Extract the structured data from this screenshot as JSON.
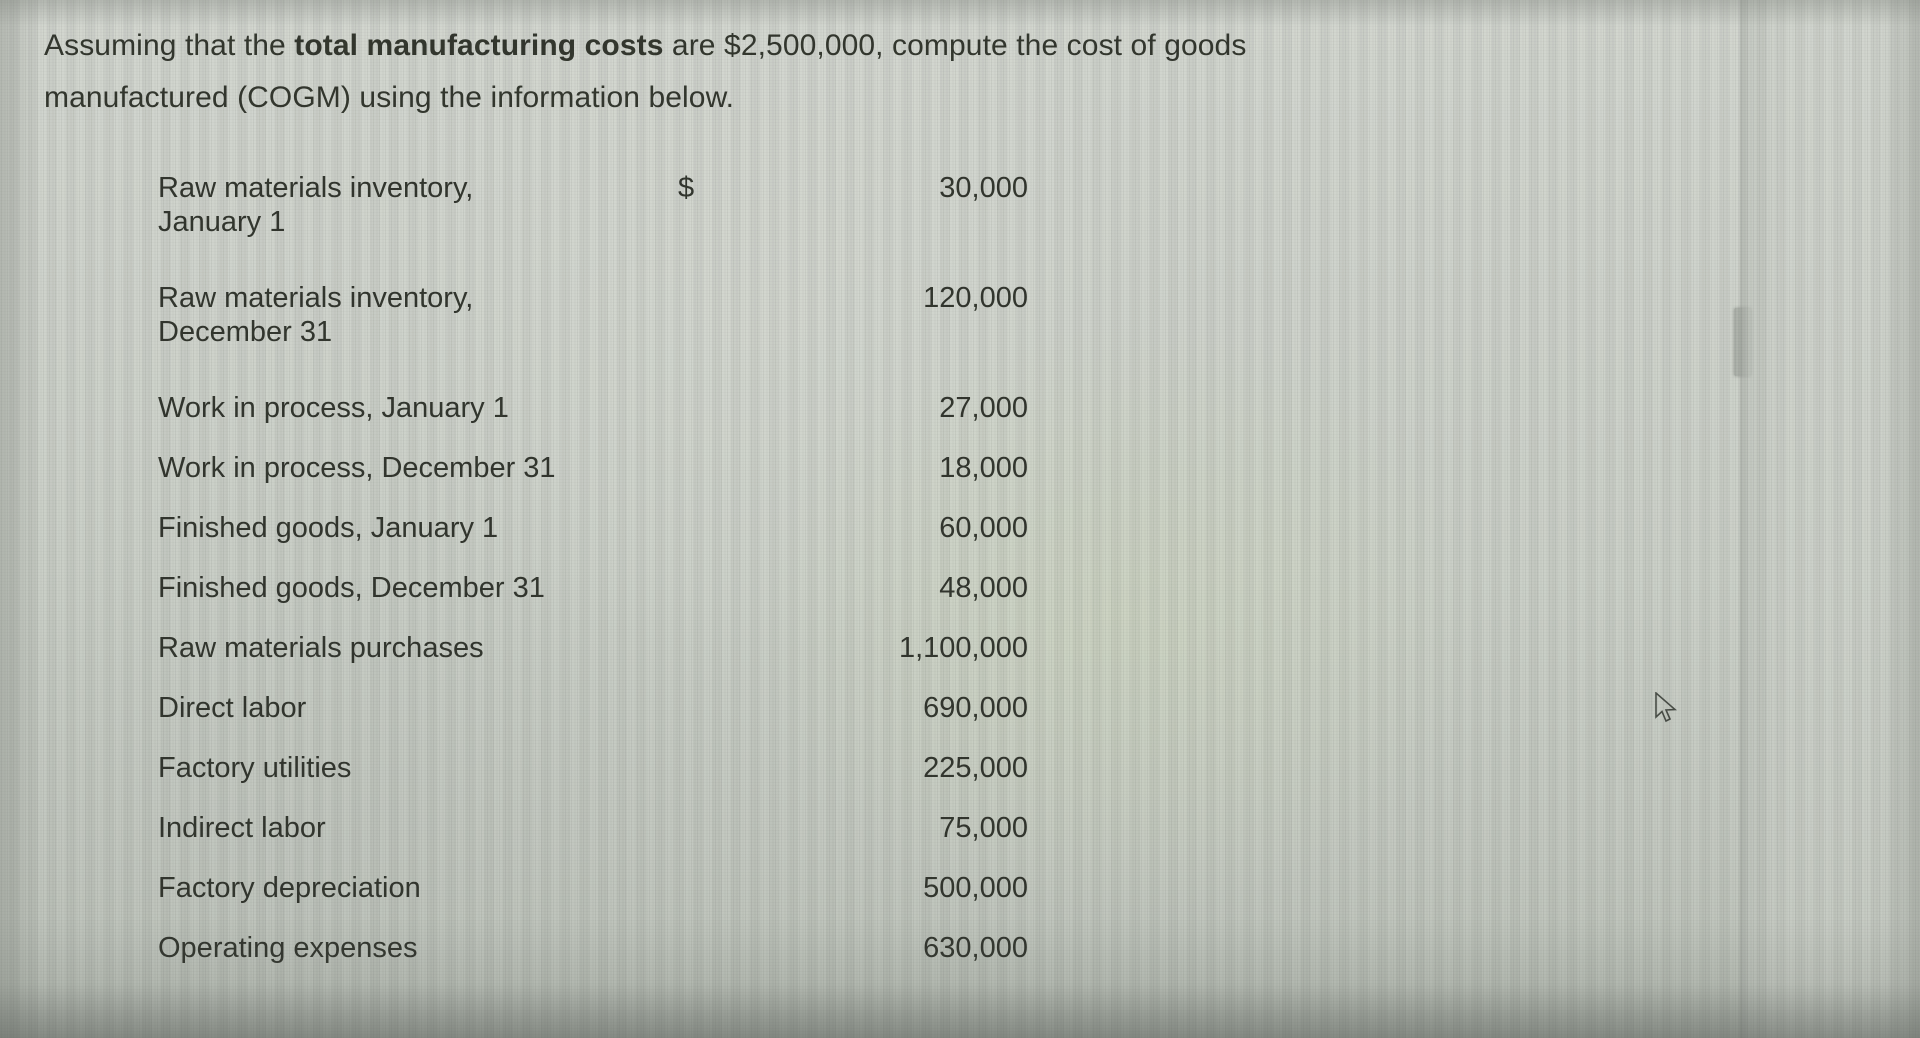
{
  "question": {
    "text_before_bold": "Assuming that the ",
    "bold_phrase": "total manufacturing costs",
    "text_after_bold": " are $2,500,000, compute the cost of goods manufactured (COGM) using the information below."
  },
  "table": {
    "currency_symbol": "$",
    "rows": [
      {
        "label": "Raw materials inventory,\nJanuary 1",
        "amount": "30,000",
        "has_currency": true
      },
      {
        "label": "Raw materials inventory,\nDecember 31",
        "amount": "120,000",
        "has_currency": false
      },
      {
        "label": "Work in process, January 1",
        "amount": "27,000",
        "has_currency": false
      },
      {
        "label": "Work in process, December 31",
        "amount": "18,000",
        "has_currency": false
      },
      {
        "label": "Finished goods, January 1",
        "amount": "60,000",
        "has_currency": false
      },
      {
        "label": "Finished goods, December 31",
        "amount": "48,000",
        "has_currency": false
      },
      {
        "label": "Raw materials purchases",
        "amount": "1,100,000",
        "has_currency": false
      },
      {
        "label": "Direct labor",
        "amount": "690,000",
        "has_currency": false
      },
      {
        "label": "Factory utilities",
        "amount": "225,000",
        "has_currency": false
      },
      {
        "label": "Indirect labor",
        "amount": "75,000",
        "has_currency": false
      },
      {
        "label": "Factory depreciation",
        "amount": "500,000",
        "has_currency": false
      },
      {
        "label": "Operating expenses",
        "amount": "630,000",
        "has_currency": false
      }
    ]
  },
  "ui": {
    "cursor_icon": "mouse-pointer-icon",
    "scrollbar_icon": "vertical-scrollbar-thumb"
  },
  "colors": {
    "text": "#33372f",
    "background": "#cbd0c8"
  }
}
